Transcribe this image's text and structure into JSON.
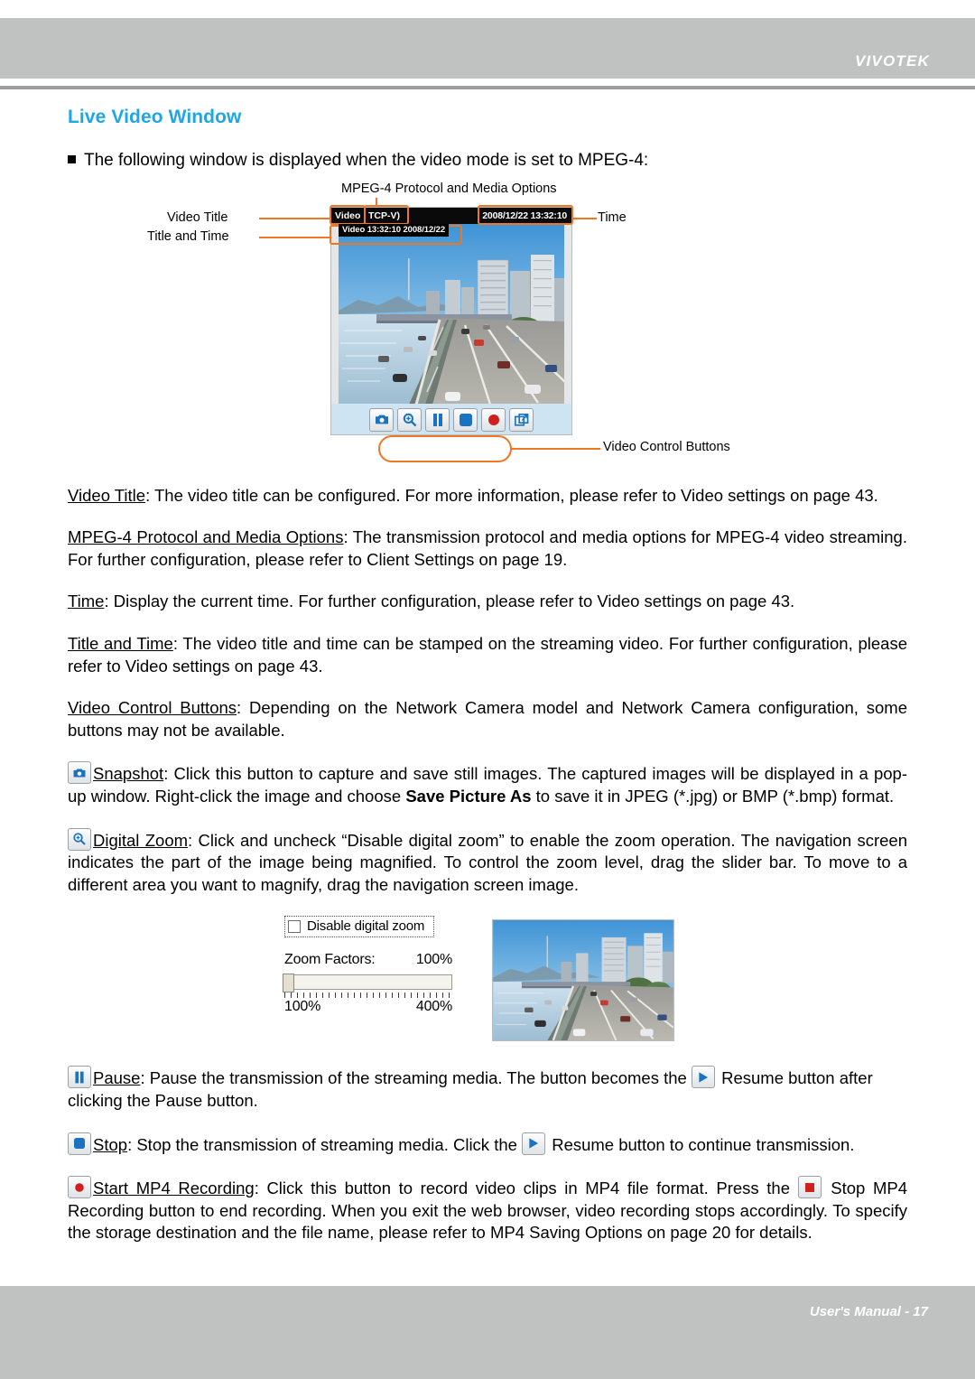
{
  "header": {
    "brand": "VIVOTEK"
  },
  "footer": {
    "text": "User's Manual - 17"
  },
  "page": {
    "section_title": "Live Video Window",
    "intro_bullet": "The following window is displayed when the video mode is set to MPEG-4:"
  },
  "diagram": {
    "callouts": {
      "protocol": "MPEG-4 Protocol and Media Options",
      "video_title": "Video Title",
      "title_and_time": "Title and Time",
      "time": "Time",
      "control_buttons": "Video Control Buttons"
    },
    "viewer": {
      "title": "Video",
      "protocol": "TCP-V)",
      "timestamp": "2008/12/22 13:32:10",
      "osd_stamp": "Video 13:32:10  2008/12/22",
      "buttons": [
        {
          "name": "snapshot-icon",
          "label": "Snapshot"
        },
        {
          "name": "digital-zoom-icon",
          "label": "Digital Zoom"
        },
        {
          "name": "pause-icon",
          "label": "Pause"
        },
        {
          "name": "stop-icon",
          "label": "Stop"
        },
        {
          "name": "record-icon",
          "label": "Start MP4 Recording"
        },
        {
          "name": "fullscreen-icon",
          "label": "Full Screen"
        }
      ]
    }
  },
  "sections": {
    "video_title": {
      "term": "Video Title",
      "body": ": The video title can be configured. For more information, please refer to Video settings on page 43."
    },
    "protocol": {
      "term": "MPEG-4 Protocol and Media Options",
      "body": ": The transmission protocol and media options for MPEG-4 video streaming. For further configuration, please refer to Client Settings on page 19."
    },
    "time": {
      "term": "Time",
      "body": ": Display the current time. For further configuration, please refer to Video settings on page 43."
    },
    "title_and_time": {
      "term": "Title and Time",
      "body": ": The video title and time can be stamped on the streaming video. For further configuration, please refer to Video settings on page 43."
    },
    "control_buttons": {
      "term": "Video Control Buttons",
      "body": ": Depending on the Network Camera model and Network Camera configuration, some buttons may not be available."
    },
    "snapshot": {
      "term": "Snapshot",
      "body_1": ": Click this button to capture and save still images. The captured images will be displayed in a pop-up window. Right-click the image and choose ",
      "emphasis": "Save Picture As",
      "body_2": " to save it in JPEG (*.jpg) or BMP (*.bmp) format."
    },
    "digital_zoom": {
      "term": "Digital Zoom",
      "body": ": Click and uncheck “Disable digital zoom” to enable the zoom operation. The navigation screen indicates the part of the image being magnified. To control the zoom level, drag the slider bar. To move to a different area you want to magnify, drag the navigation screen image."
    },
    "pause": {
      "term": "Pause",
      "body_1": ": Pause the transmission of the streaming media. The button becomes the ",
      "body_2": " Resume button after clicking the Pause button."
    },
    "stop": {
      "term": "Stop",
      "body_1": ": Stop the transmission of streaming media. Click the ",
      "body_2": " Resume button to continue transmission."
    },
    "recording": {
      "term": "Start MP4 Recording",
      "body_1": ": Click this button to record video clips in MP4 file format. Press the ",
      "body_2": " Stop MP4 Recording button to end recording. When you exit the web browser, video recording stops accordingly. To specify the storage destination and the file name, please refer to MP4 Saving Options on page 20 for details."
    }
  },
  "zoom_panel": {
    "checkbox_label": "Disable digital zoom",
    "checkbox_checked": false,
    "factors_label": "Zoom Factors:",
    "factors_value": "100%",
    "range_min": "100%",
    "range_max": "400%"
  },
  "colors": {
    "accent_blue": "#1ca7e8",
    "callout_orange": "#ef7622",
    "header_gray": "#c0c2c2",
    "toolbar_blue": "#cfe4f2"
  }
}
